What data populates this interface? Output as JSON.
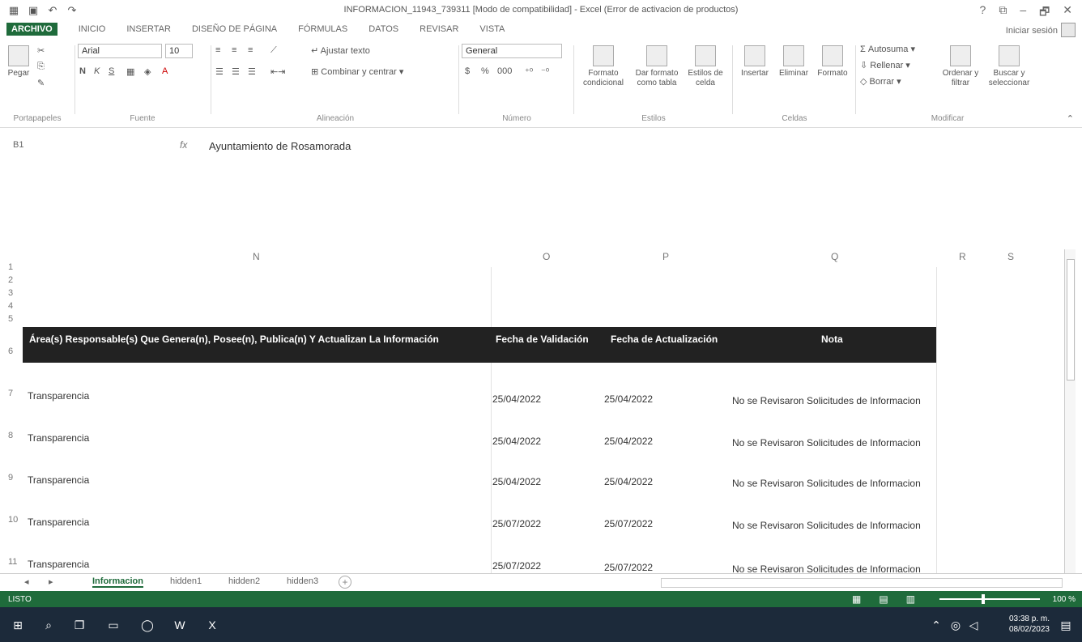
{
  "window": {
    "title": "INFORMACION_11943_739311 [Modo de compatibilidad] - Excel (Error de activacion de productos)",
    "controls": [
      "?",
      "⧉",
      "–",
      "🗗",
      "✕"
    ]
  },
  "menu": {
    "tabs": [
      "ARCHIVO",
      "INICIO",
      "INSERTAR",
      "DISEÑO DE PÁGINA",
      "FÓRMULAS",
      "DATOS",
      "REVISAR",
      "VISTA"
    ],
    "signin": "Iniciar sesión"
  },
  "ribbon": {
    "paste_label": "Pegar",
    "font_name": "Arial",
    "font_size": "10",
    "bold": "N",
    "italic": "K",
    "underline": "S",
    "wrap_text": "Ajustar texto",
    "merge_center": "Combinar y centrar",
    "number_format": "General",
    "currency": "$",
    "percent": "%",
    "thousands": "000",
    "conditional_format": "Formato condicional",
    "format_table": "Dar formato como tabla",
    "cell_styles": "Estilos de celda",
    "insert": "Insertar",
    "delete": "Eliminar",
    "format": "Formato",
    "autosum": "Autosuma",
    "fill": "Rellenar",
    "clear": "Borrar",
    "sort_filter": "Ordenar y filtrar",
    "find_select": "Buscar y seleccionar",
    "groups": {
      "clipboard": "Portapapeles",
      "font": "Fuente",
      "alignment": "Alineación",
      "number": "Número",
      "styles": "Estilos",
      "cells": "Celdas",
      "edit": "Modificar"
    }
  },
  "formula_bar": {
    "name_box": "B1",
    "fx": "fx",
    "value": "Ayuntamiento de Rosamorada"
  },
  "sheet": {
    "columns": [
      "N",
      "O",
      "P",
      "Q",
      "R",
      "S"
    ],
    "row_numbers": [
      "1",
      "2",
      "3",
      "4",
      "5",
      "6",
      "7",
      "8",
      "9",
      "10",
      "11"
    ],
    "header": {
      "area": "Área(s) Responsable(s) Que Genera(n), Posee(n), Publica(n) Y Actualizan La Información",
      "validation": "Fecha de Validación",
      "update": "Fecha de Actualización",
      "note": "Nota"
    },
    "rows": [
      {
        "area": "Transparencia",
        "validation": "25/04/2022",
        "update": "25/04/2022",
        "note": "No se Revisaron Solicitudes de Informacion"
      },
      {
        "area": "Transparencia",
        "validation": "25/04/2022",
        "update": "25/04/2022",
        "note": "No se Revisaron Solicitudes de Informacion"
      },
      {
        "area": "Transparencia",
        "validation": "25/04/2022",
        "update": "25/04/2022",
        "note": "No se Revisaron Solicitudes de Informacion"
      },
      {
        "area": "Transparencia",
        "validation": "25/07/2022",
        "update": "25/07/2022",
        "note": "No se Revisaron Solicitudes de Informacion"
      },
      {
        "area": "Transparencia",
        "validation": "25/07/2022",
        "update": "25/07/2022",
        "note": "No se Revisaron Solicitudes de Informacion"
      }
    ]
  },
  "sheet_tabs": [
    "Informacion",
    "hidden1",
    "hidden2",
    "hidden3"
  ],
  "status": {
    "text": "LISTO",
    "zoom": "100 %"
  },
  "taskbar": {
    "time": "03:38 p. m.",
    "date": "08/02/2023"
  }
}
